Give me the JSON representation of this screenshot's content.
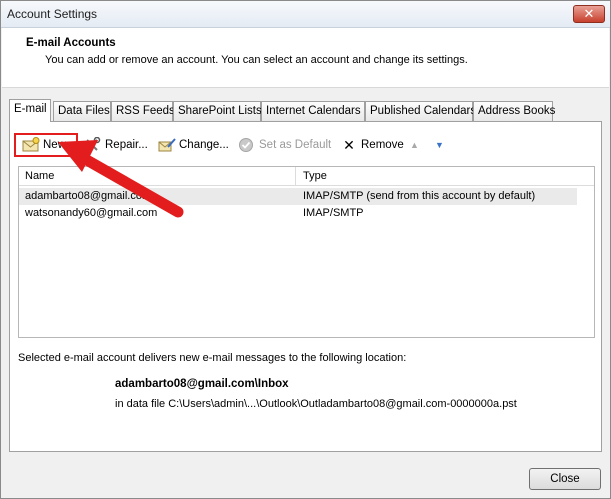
{
  "window": {
    "title": "Account Settings",
    "close_glyph": "✕"
  },
  "header": {
    "title": "E-mail Accounts",
    "description": "You can add or remove an account. You can select an account and change its settings."
  },
  "tabs": [
    {
      "label": "E-mail",
      "active": true
    },
    {
      "label": "Data Files"
    },
    {
      "label": "RSS Feeds"
    },
    {
      "label": "SharePoint Lists"
    },
    {
      "label": "Internet Calendars"
    },
    {
      "label": "Published Calendars"
    },
    {
      "label": "Address Books"
    }
  ],
  "toolbar": {
    "new_label": "New...",
    "repair_label": "Repair...",
    "change_label": "Change...",
    "set_default_label": "Set as Default",
    "remove_label": "Remove",
    "remove_glyph": "✕",
    "up_glyph": "▲",
    "down_glyph": "▼"
  },
  "accounts": {
    "columns": {
      "name": "Name",
      "type": "Type"
    },
    "rows": [
      {
        "name": "adambarto08@gmail.com",
        "type": "IMAP/SMTP (send from this account by default)"
      },
      {
        "name": "watsonandy60@gmail.com",
        "type": "IMAP/SMTP"
      }
    ]
  },
  "location": {
    "label": "Selected e-mail account delivers new e-mail messages to the following location:",
    "path": "adambarto08@gmail.com\\Inbox",
    "file": "in data file C:\\Users\\admin\\...\\Outlook\\Outladambarto08@gmail.com-0000000a.pst"
  },
  "footer": {
    "close_label": "Close"
  },
  "colors": {
    "highlight": "#e31d1d",
    "arrow": "#e31d1d"
  },
  "icons": [
    "new-account-icon",
    "repair-icon",
    "change-icon",
    "check-icon",
    "remove-icon",
    "up-arrow-icon",
    "down-arrow-icon",
    "close-icon"
  ]
}
